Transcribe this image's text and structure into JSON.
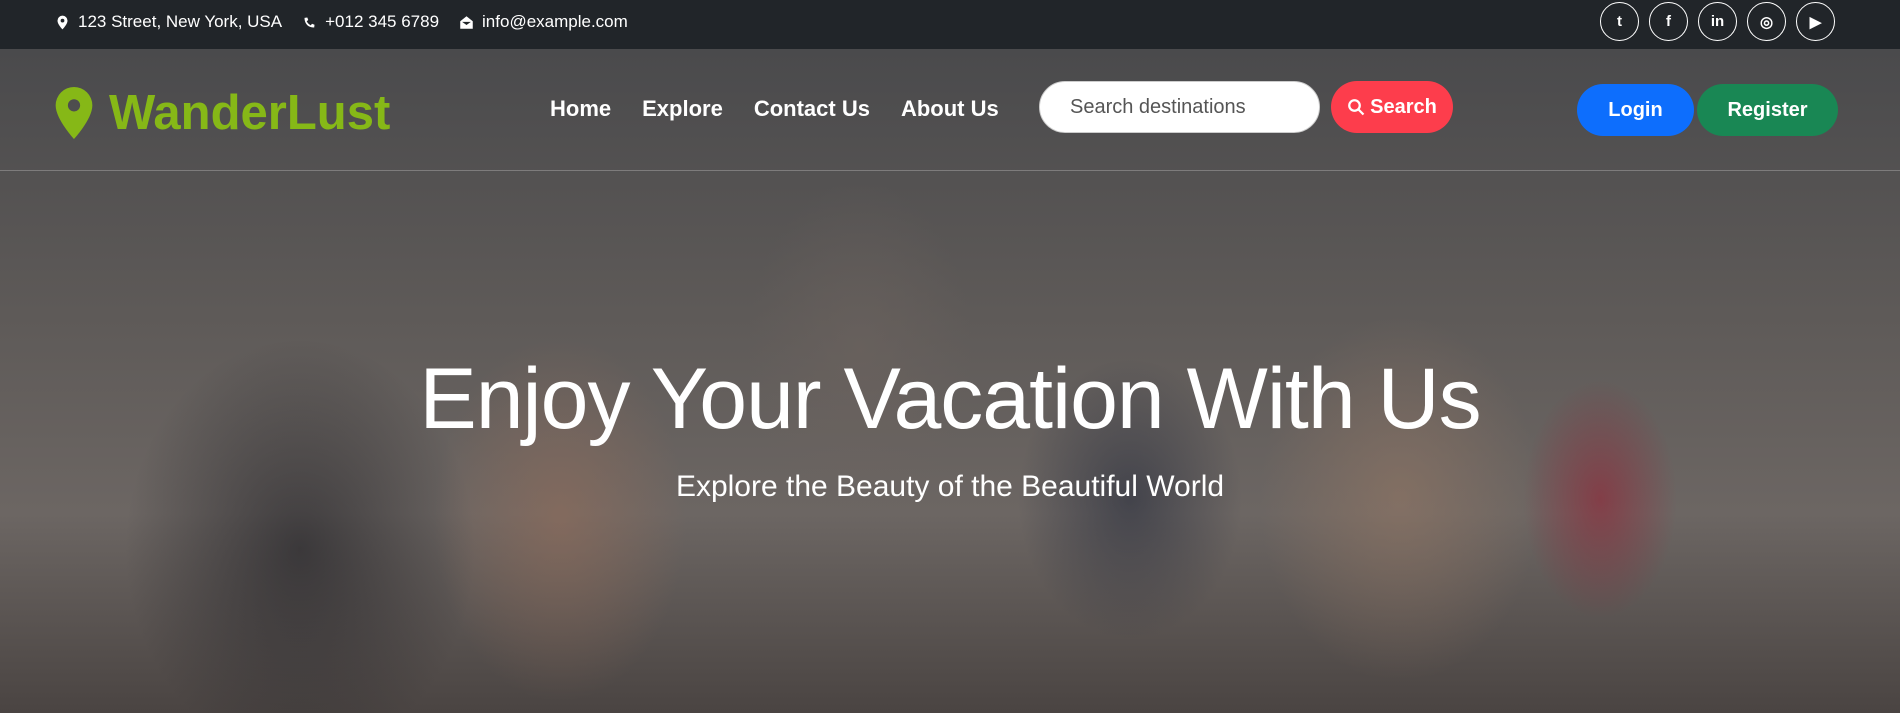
{
  "topbar": {
    "address": "123 Street, New York, USA",
    "phone": "+012 345 6789",
    "email": "info@example.com",
    "social": [
      {
        "icon": "twitter-icon",
        "glyph": "t"
      },
      {
        "icon": "facebook-icon",
        "glyph": "f"
      },
      {
        "icon": "linkedin-icon",
        "glyph": "in"
      },
      {
        "icon": "instagram-icon",
        "glyph": "◎"
      },
      {
        "icon": "youtube-icon",
        "glyph": "▶"
      }
    ]
  },
  "brand": {
    "name": "WanderLust",
    "color": "#86b817"
  },
  "nav": [
    "Home",
    "Explore",
    "Contact Us",
    "About Us"
  ],
  "search": {
    "placeholder": "Search destinations",
    "button": "Search"
  },
  "auth": {
    "login": "Login",
    "register": "Register"
  },
  "hero": {
    "title": "Enjoy Your Vacation With Us",
    "subtitle": "Explore the Beauty of the Beautiful World"
  }
}
